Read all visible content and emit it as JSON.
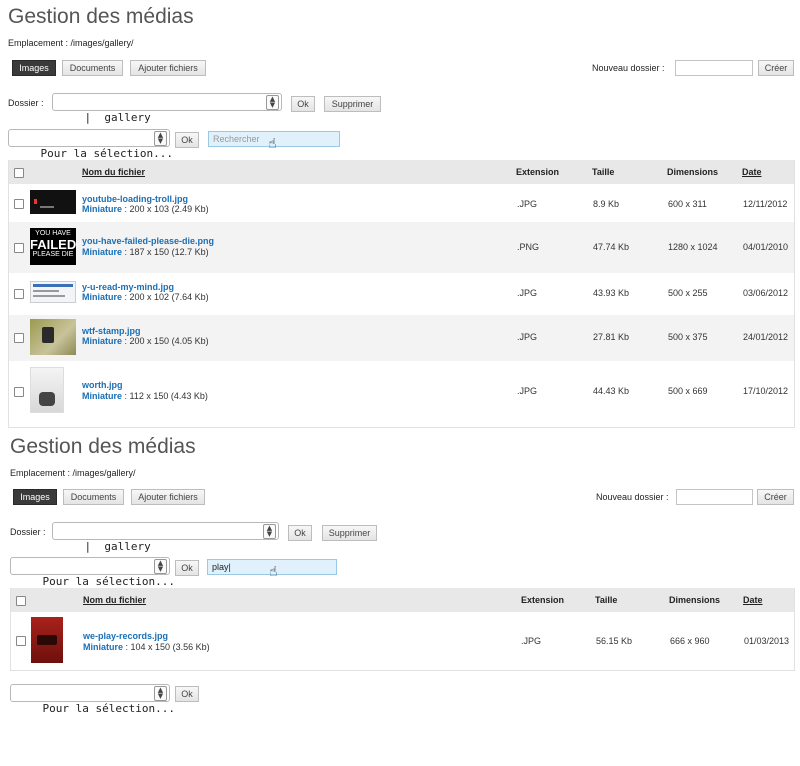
{
  "common": {
    "title": "Gestion des médias",
    "location": "Emplacement : /images/gallery/",
    "tabs": [
      "Images",
      "Documents",
      "Ajouter fichiers"
    ],
    "new_folder_label": "Nouveau dossier :",
    "create_label": "Créer",
    "folder_label": "Dossier :",
    "folder_value": "|  gallery",
    "ok_label": "Ok",
    "delete_label": "Supprimer",
    "selection_label": "Pour la sélection...",
    "columns": [
      "Nom du fichier",
      "Extension",
      "Taille",
      "Dimensions",
      "Date"
    ],
    "miniature_label": "Miniature"
  },
  "panel1": {
    "search_placeholder": "Rechercher",
    "rows": [
      {
        "name": "youtube-loading-troll.jpg",
        "mini": ": 200 x 103 (2.49 Kb)",
        "ext": ".JPG",
        "size": "8.9 Kb",
        "dim": "600 x 311",
        "date": "12/11/2012"
      },
      {
        "name": "you-have-failed-please-die.png",
        "mini": ": 187 x 150 (12.7 Kb)",
        "ext": ".PNG",
        "size": "47.74 Kb",
        "dim": "1280 x 1024",
        "date": "04/01/2010",
        "thumb_text": [
          "YOU HAVE",
          "FAILED",
          "PLEASE DIE"
        ]
      },
      {
        "name": "y-u-read-my-mind.jpg",
        "mini": ": 200 x 102 (7.64 Kb)",
        "ext": ".JPG",
        "size": "43.93 Kb",
        "dim": "500 x 255",
        "date": "03/06/2012"
      },
      {
        "name": "wtf-stamp.jpg",
        "mini": ": 200 x 150 (4.05 Kb)",
        "ext": ".JPG",
        "size": "27.81 Kb",
        "dim": "500 x 375",
        "date": "24/01/2012"
      },
      {
        "name": "worth.jpg",
        "mini": ": 112 x 150 (4.43 Kb)",
        "ext": ".JPG",
        "size": "44.43 Kb",
        "dim": "500 x 669",
        "date": "17/10/2012"
      }
    ]
  },
  "panel2": {
    "search_value": "play",
    "rows": [
      {
        "name": "we-play-records.jpg",
        "mini": ": 104 x 150 (3.56 Kb)",
        "ext": ".JPG",
        "size": "56.15 Kb",
        "dim": "666 x 960",
        "date": "01/03/2013"
      }
    ]
  },
  "icons": {
    "cursor": "hand-pointer-icon",
    "select_arrows": "select-arrows-icon"
  }
}
